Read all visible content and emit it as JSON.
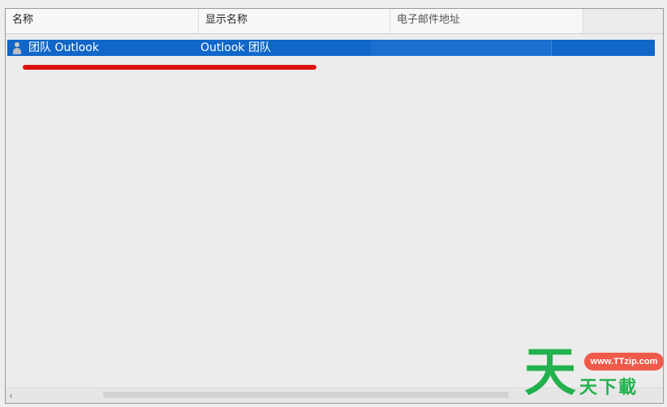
{
  "columns": {
    "name": "名称",
    "display_name": "显示名称",
    "email": "电子邮件地址"
  },
  "rows": [
    {
      "name": "团队 Outlook",
      "display_name": "Outlook 团队",
      "email": "",
      "selected": true,
      "icon": "person-icon"
    }
  ],
  "annotation": {
    "underline_color": "#dd1111"
  },
  "watermark": {
    "logo_char": "天",
    "url": "www.TTzip.com",
    "text": "天下載"
  },
  "colors": {
    "selection": "#1167c9",
    "watermark_green": "#23b14d",
    "watermark_badge": "#ef5a4a"
  }
}
